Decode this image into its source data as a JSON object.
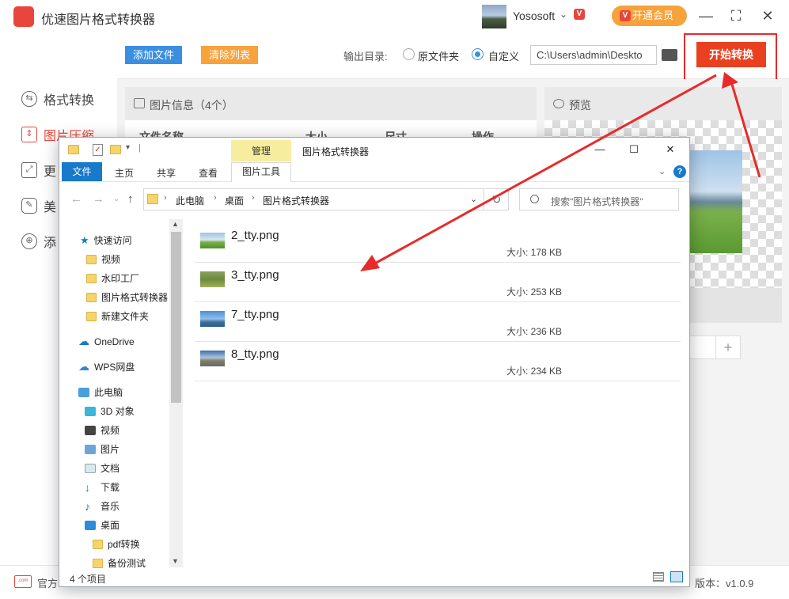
{
  "app": {
    "title": "优速图片格式转换器",
    "username": "Yososoft",
    "vip_button": "开通会员",
    "vip_badge": "V",
    "accent_color": "#e94120"
  },
  "window_controls": {
    "minimize": "—",
    "maximize": "⛶",
    "close": "✕"
  },
  "sidebar": {
    "items": [
      {
        "label": "格式转换",
        "icon": "format-convert-icon"
      },
      {
        "label": "图片压缩",
        "icon": "image-compress-icon"
      },
      {
        "label": "更",
        "icon": "resize-icon"
      },
      {
        "label": "美",
        "icon": "beautify-icon"
      },
      {
        "label": "添",
        "icon": "watermark-icon"
      }
    ]
  },
  "toolbar": {
    "add_file": "添加文件",
    "clear_list": "清除列表",
    "output_label": "输出目录:",
    "option_original": "原文件夹",
    "option_custom": "自定义",
    "selected_option": "自定义",
    "output_path": "C:\\Users\\admin\\Deskto",
    "start_button": "开始转换"
  },
  "info_panel": {
    "title": "图片信息（4个）",
    "columns": [
      "文件名称",
      "大小",
      "尺寸",
      "操作"
    ]
  },
  "preview_panel": {
    "title": "预览"
  },
  "footer": {
    "official_label": "官方",
    "official_icon_text": ".com",
    "version": "版本：v1.0.9"
  },
  "explorer": {
    "title": "图片格式转换器",
    "manage_tab": "管理",
    "ribbon_tabs": [
      "文件",
      "主页",
      "共享",
      "查看"
    ],
    "picture_tools": "图片工具",
    "breadcrumb": [
      "此电脑",
      "桌面",
      "图片格式转换器"
    ],
    "search_placeholder": "搜索\"图片格式转换器\"",
    "nav_items": [
      {
        "label": "快速访问",
        "icon": "star-icon",
        "indent": 0
      },
      {
        "label": "视频",
        "icon": "folder-icon",
        "indent": 1
      },
      {
        "label": "水印工厂",
        "icon": "folder-icon",
        "indent": 1
      },
      {
        "label": "图片格式转换器",
        "icon": "folder-icon",
        "indent": 1
      },
      {
        "label": "新建文件夹",
        "icon": "folder-icon",
        "indent": 1
      },
      {
        "label": "OneDrive",
        "icon": "cloud-icon",
        "indent": 0
      },
      {
        "label": "WPS网盘",
        "icon": "wps-cloud-icon",
        "indent": 0
      },
      {
        "label": "此电脑",
        "icon": "computer-icon",
        "indent": 0
      },
      {
        "label": "3D 对象",
        "icon": "cube-icon",
        "indent": 1
      },
      {
        "label": "视频",
        "icon": "video-icon",
        "indent": 1
      },
      {
        "label": "图片",
        "icon": "picture-icon",
        "indent": 1
      },
      {
        "label": "文档",
        "icon": "document-icon",
        "indent": 1
      },
      {
        "label": "下载",
        "icon": "download-icon",
        "indent": 1
      },
      {
        "label": "音乐",
        "icon": "music-icon",
        "indent": 1
      },
      {
        "label": "桌面",
        "icon": "desktop-icon",
        "indent": 1
      },
      {
        "label": "pdf转换",
        "icon": "folder-icon",
        "indent": 2
      },
      {
        "label": "备份测试",
        "icon": "folder-icon",
        "indent": 2
      }
    ],
    "files": [
      {
        "name": "2_tty.png",
        "size": "大小: 178 KB"
      },
      {
        "name": "3_tty.png",
        "size": "大小: 253 KB"
      },
      {
        "name": "7_tty.png",
        "size": "大小: 236 KB"
      },
      {
        "name": "8_tty.png",
        "size": "大小: 234 KB"
      }
    ],
    "item_count": "4 个项目"
  }
}
